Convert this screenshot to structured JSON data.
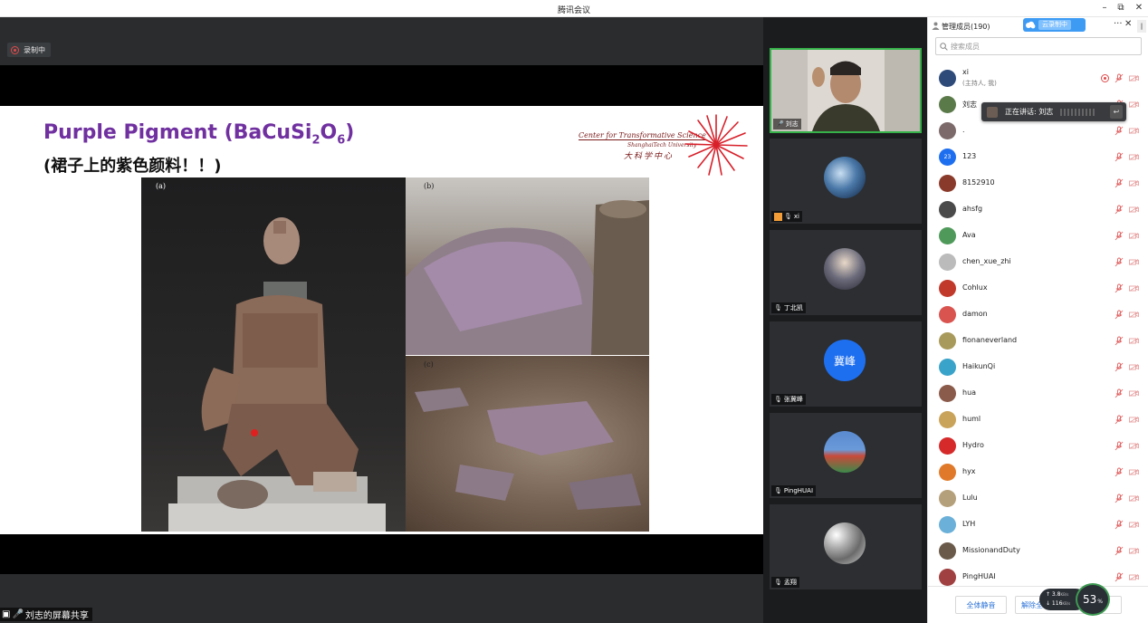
{
  "window": {
    "title": "腾讯会议",
    "minimize": "–",
    "restore": "⧉",
    "close": "✕"
  },
  "stage": {
    "recording_label": "录制中",
    "share_label": "刘志的屏幕共享"
  },
  "slide": {
    "title_prefix": "Purple Pigment (BaCuSi",
    "title_sub1": "2",
    "title_mid": "O",
    "title_sub2": "6",
    "title_suffix": ")",
    "subtitle": "(裙子上的紫色颜料！！)",
    "logo_line1": "Center for Transformative Science",
    "logo_line2": "ShanghaiTech University",
    "logo_line3": "大科学中心",
    "panel_labels": [
      "(a)",
      "(b)",
      "(c)"
    ]
  },
  "video_tiles": [
    {
      "name": "刘志",
      "avatar_text": "",
      "host": false,
      "active": true
    },
    {
      "name": "xi",
      "avatar_text": "",
      "host": true,
      "active": false
    },
    {
      "name": "丁北凯",
      "avatar_text": "",
      "host": false,
      "active": false
    },
    {
      "name": "张冀峰",
      "avatar_text": "冀峰",
      "host": false,
      "active": false
    },
    {
      "name": "PingHUAI",
      "avatar_text": "",
      "host": false,
      "active": false
    },
    {
      "name": "孟翔",
      "avatar_text": "",
      "host": false,
      "active": false
    }
  ],
  "panel": {
    "title": "管理成员(190)",
    "cloud_label": "云录制中",
    "more": "···",
    "close": "✕",
    "side_toggle": "‖",
    "search_placeholder": "搜索成员",
    "speaking_label": "正在讲话: 刘志",
    "foot_mute_all": "全体静音",
    "foot_unmute_all": "解除全"
  },
  "members": [
    {
      "name": "xi",
      "sub": "(主持人, 我)",
      "avatar_color": "#2d4a78",
      "recording": true
    },
    {
      "name": "刘志",
      "sub": "",
      "avatar_color": "#5b7a4a",
      "recording": false
    },
    {
      "name": ".",
      "sub": "",
      "avatar_color": "#7c6a6a",
      "recording": false
    },
    {
      "name": "123",
      "sub": "",
      "avatar_color": "#1e6ff0",
      "avatar_text": "23",
      "recording": false
    },
    {
      "name": "8152910",
      "sub": "",
      "avatar_color": "#8a3a2a",
      "recording": false
    },
    {
      "name": "ahsfg",
      "sub": "",
      "avatar_color": "#4a4a4a",
      "recording": false
    },
    {
      "name": "Ava",
      "sub": "",
      "avatar_color": "#4f9a5a",
      "recording": false
    },
    {
      "name": "chen_xue_zhi",
      "sub": "",
      "avatar_color": "#bbbbbb",
      "recording": false
    },
    {
      "name": "Cohlux",
      "sub": "",
      "avatar_color": "#c0392b",
      "recording": false
    },
    {
      "name": "damon",
      "sub": "",
      "avatar_color": "#d9534f",
      "recording": false
    },
    {
      "name": "fionaneverland",
      "sub": "",
      "avatar_color": "#a89a5a",
      "recording": false
    },
    {
      "name": "HaikunQi",
      "sub": "",
      "avatar_color": "#3aa3c9",
      "recording": false
    },
    {
      "name": "hua",
      "sub": "",
      "avatar_color": "#8a5a4a",
      "recording": false
    },
    {
      "name": "huml",
      "sub": "",
      "avatar_color": "#c9a35a",
      "recording": false
    },
    {
      "name": "Hydro",
      "sub": "",
      "avatar_color": "#d62a2a",
      "recording": false
    },
    {
      "name": "hyx",
      "sub": "",
      "avatar_color": "#e07a2a",
      "recording": false
    },
    {
      "name": "Lulu",
      "sub": "",
      "avatar_color": "#b4a07a",
      "recording": false
    },
    {
      "name": "LYH",
      "sub": "",
      "avatar_color": "#6ab0d8",
      "recording": false
    },
    {
      "name": "MissionandDuty",
      "sub": "",
      "avatar_color": "#6a5a4a",
      "recording": false
    },
    {
      "name": "PingHUAI",
      "sub": "",
      "avatar_color": "#a04040",
      "recording": false
    }
  ],
  "network": {
    "upload": "↑ 3.8",
    "upload_unit": "KB/s",
    "download": "↓ 116",
    "download_unit": "KB/s",
    "cpu": "53",
    "cpu_unit": "%"
  },
  "colors": {
    "title_purple": "#7030a0",
    "active_tile": "#36b14a",
    "accent_blue": "#3d9bf4",
    "mute_red": "#e06060"
  }
}
